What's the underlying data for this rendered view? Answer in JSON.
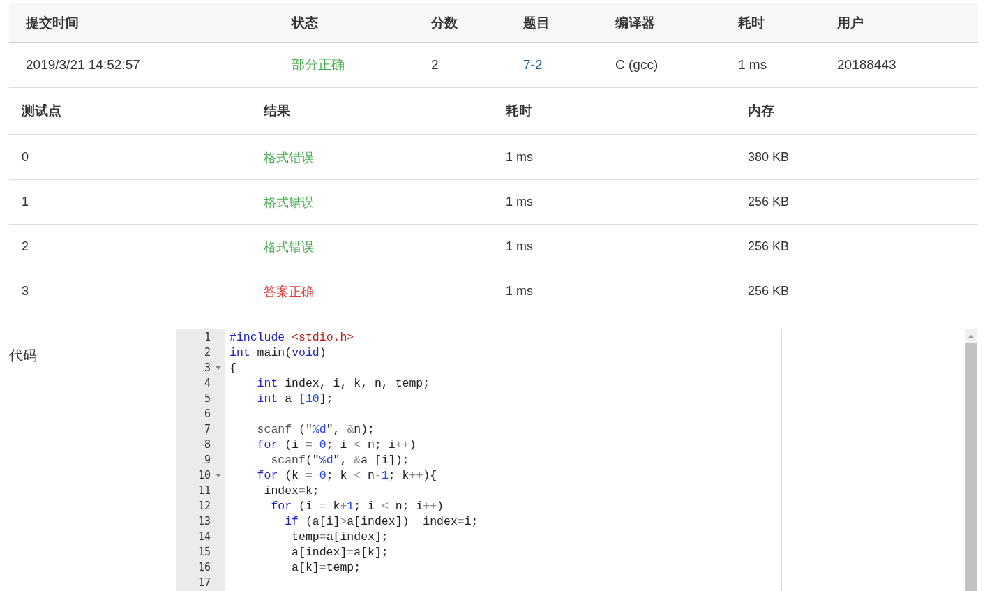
{
  "submission": {
    "columns": [
      "提交时间",
      "状态",
      "分数",
      "题目",
      "编译器",
      "耗时",
      "用户"
    ],
    "row": [
      {
        "kind": "text",
        "text": "2019/3/21 14:52:57"
      },
      {
        "kind": "status",
        "text": "部分正确",
        "color": "#4caf50"
      },
      {
        "kind": "text",
        "text": "2"
      },
      {
        "kind": "link",
        "text": "7-2"
      },
      {
        "kind": "text",
        "text": "C (gcc)"
      },
      {
        "kind": "text",
        "text": "1 ms"
      },
      {
        "kind": "text",
        "text": "20188443"
      }
    ]
  },
  "tests": {
    "columns": [
      "测试点",
      "结果",
      "耗时",
      "内存"
    ],
    "rows": [
      {
        "case": "0",
        "result": "格式错误",
        "color": "#4caf50",
        "time": "1 ms",
        "memory": "380 KB"
      },
      {
        "case": "1",
        "result": "格式错误",
        "color": "#4caf50",
        "time": "1 ms",
        "memory": "256 KB"
      },
      {
        "case": "2",
        "result": "格式错误",
        "color": "#4caf50",
        "time": "1 ms",
        "memory": "256 KB"
      },
      {
        "case": "3",
        "result": "答案正确",
        "color": "#e53935",
        "time": "1 ms",
        "memory": "256 KB"
      }
    ]
  },
  "code": {
    "label": "代码",
    "lines": [
      {
        "number": "1",
        "fold": false,
        "tokens": [
          {
            "kind": "kw",
            "text": "#include"
          },
          {
            "kind": "hdr",
            "text": " <stdio.h>"
          }
        ]
      },
      {
        "number": "2",
        "fold": false,
        "tokens": [
          {
            "kind": "kw",
            "text": "int"
          },
          {
            "kind": "plain",
            "text": " main("
          },
          {
            "kind": "kw",
            "text": "void"
          },
          {
            "kind": "plain",
            "text": ")"
          }
        ]
      },
      {
        "number": "3",
        "fold": true,
        "tokens": [
          {
            "kind": "plain",
            "text": "{"
          }
        ]
      },
      {
        "number": "4",
        "fold": false,
        "tokens": [
          {
            "kind": "kw",
            "text": "    int"
          },
          {
            "kind": "plain",
            "text": " index, i, k, n, temp;"
          }
        ]
      },
      {
        "number": "5",
        "fold": false,
        "tokens": [
          {
            "kind": "kw",
            "text": "    int"
          },
          {
            "kind": "plain",
            "text": " a ["
          },
          {
            "kind": "num",
            "text": "10"
          },
          {
            "kind": "plain",
            "text": "];"
          }
        ]
      },
      {
        "number": "6",
        "fold": false
      },
      {
        "number": "7",
        "fold": false,
        "tokens": [
          {
            "kind": "fn",
            "text": "    scanf"
          },
          {
            "kind": "plain",
            "text": " (\""
          },
          {
            "kind": "num",
            "text": "%d"
          },
          {
            "kind": "plain",
            "text": "\", "
          },
          {
            "kind": "op",
            "text": "&"
          },
          {
            "kind": "plain",
            "text": "n);"
          }
        ]
      },
      {
        "number": "8",
        "fold": false,
        "tokens": [
          {
            "kind": "kw",
            "text": "    for"
          },
          {
            "kind": "plain",
            "text": " (i "
          },
          {
            "kind": "op",
            "text": "="
          },
          {
            "kind": "num",
            "text": " 0"
          },
          {
            "kind": "plain",
            "text": "; i "
          },
          {
            "kind": "op",
            "text": "<"
          },
          {
            "kind": "plain",
            "text": " n; i"
          },
          {
            "kind": "op",
            "text": "++"
          },
          {
            "kind": "plain",
            "text": ")"
          }
        ]
      },
      {
        "number": "9",
        "fold": false,
        "tokens": [
          {
            "kind": "fn",
            "text": "      scanf"
          },
          {
            "kind": "plain",
            "text": "(\""
          },
          {
            "kind": "num",
            "text": "%d"
          },
          {
            "kind": "plain",
            "text": "\", "
          },
          {
            "kind": "op",
            "text": "&"
          },
          {
            "kind": "plain",
            "text": "a [i]);"
          }
        ]
      },
      {
        "number": "10",
        "fold": true,
        "tokens": [
          {
            "kind": "kw",
            "text": "    for"
          },
          {
            "kind": "plain",
            "text": " (k "
          },
          {
            "kind": "op",
            "text": "="
          },
          {
            "kind": "num",
            "text": " 0"
          },
          {
            "kind": "plain",
            "text": "; k "
          },
          {
            "kind": "op",
            "text": "<"
          },
          {
            "kind": "plain",
            "text": " n"
          },
          {
            "kind": "op",
            "text": "-"
          },
          {
            "kind": "num",
            "text": "1"
          },
          {
            "kind": "plain",
            "text": "; k"
          },
          {
            "kind": "op",
            "text": "++"
          },
          {
            "kind": "plain",
            "text": "){"
          }
        ]
      },
      {
        "number": "11",
        "fold": false,
        "tokens": [
          {
            "kind": "plain",
            "text": "     index"
          },
          {
            "kind": "op",
            "text": "="
          },
          {
            "kind": "plain",
            "text": "k;"
          }
        ]
      },
      {
        "number": "12",
        "fold": false,
        "tokens": [
          {
            "kind": "kw",
            "text": "      for"
          },
          {
            "kind": "plain",
            "text": " (i "
          },
          {
            "kind": "op",
            "text": "="
          },
          {
            "kind": "plain",
            "text": " k"
          },
          {
            "kind": "op",
            "text": "+"
          },
          {
            "kind": "num",
            "text": "1"
          },
          {
            "kind": "plain",
            "text": "; i "
          },
          {
            "kind": "op",
            "text": "<"
          },
          {
            "kind": "plain",
            "text": " n; i"
          },
          {
            "kind": "op",
            "text": "++"
          },
          {
            "kind": "plain",
            "text": ")"
          }
        ]
      },
      {
        "number": "13",
        "fold": false,
        "tokens": [
          {
            "kind": "kw",
            "text": "        if"
          },
          {
            "kind": "plain",
            "text": " (a[i]"
          },
          {
            "kind": "op",
            "text": ">"
          },
          {
            "kind": "plain",
            "text": "a[index])  index"
          },
          {
            "kind": "op",
            "text": "="
          },
          {
            "kind": "plain",
            "text": "i;"
          }
        ]
      },
      {
        "number": "14",
        "fold": false,
        "tokens": [
          {
            "kind": "plain",
            "text": "         temp"
          },
          {
            "kind": "op",
            "text": "="
          },
          {
            "kind": "plain",
            "text": "a[index];"
          }
        ]
      },
      {
        "number": "15",
        "fold": false,
        "tokens": [
          {
            "kind": "plain",
            "text": "         a[index]"
          },
          {
            "kind": "op",
            "text": "="
          },
          {
            "kind": "plain",
            "text": "a[k];"
          }
        ]
      },
      {
        "number": "16",
        "fold": false,
        "tokens": [
          {
            "kind": "plain",
            "text": "         a[k]"
          },
          {
            "kind": "op",
            "text": "="
          },
          {
            "kind": "plain",
            "text": "temp;"
          }
        ]
      },
      {
        "number": "17",
        "fold": false
      }
    ]
  }
}
